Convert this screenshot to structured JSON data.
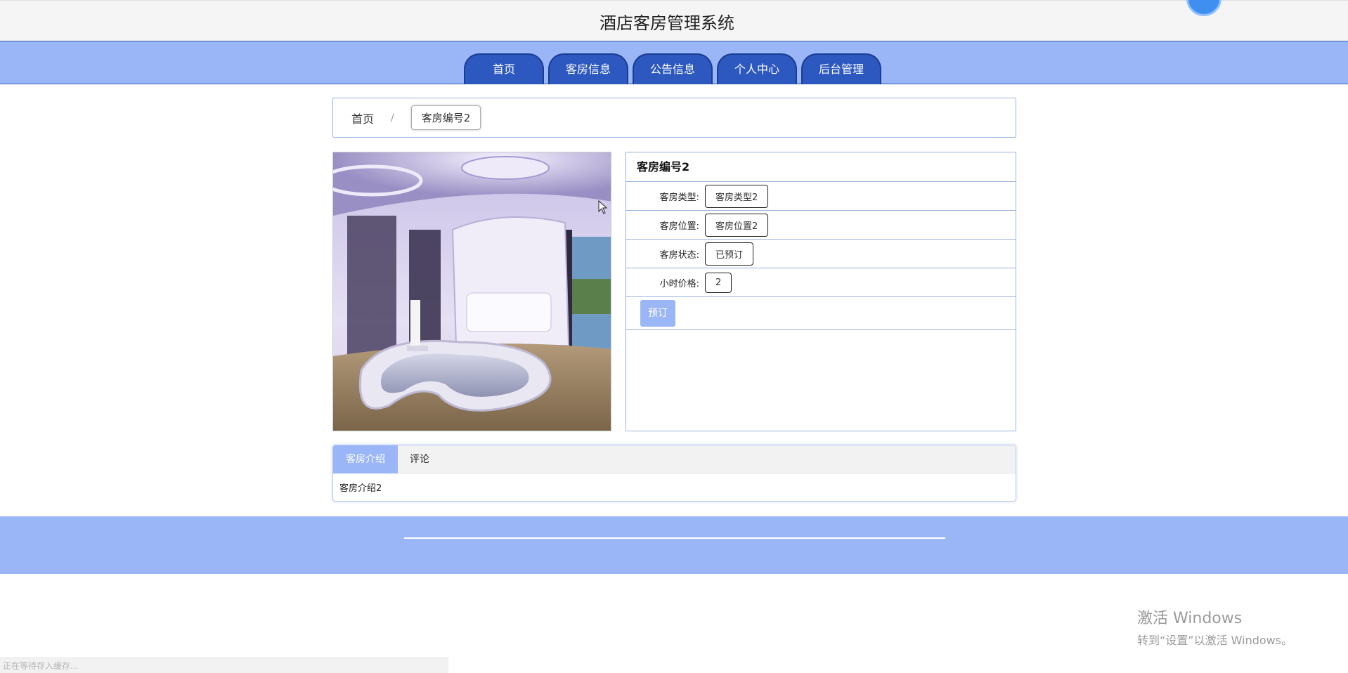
{
  "header": {
    "title": "酒店客房管理系统"
  },
  "nav": {
    "items": [
      "首页",
      "客房信息",
      "公告信息",
      "个人中心",
      "后台管理"
    ]
  },
  "breadcrumb": {
    "home": "首页",
    "separator": "/",
    "current": "客房编号2"
  },
  "room": {
    "image_icon": "room-photo",
    "title": "客房编号2",
    "fields": [
      {
        "label": "客房类型:",
        "value": "客房类型2"
      },
      {
        "label": "客房位置:",
        "value": "客房位置2"
      },
      {
        "label": "客房状态:",
        "value": "已预订"
      },
      {
        "label": "小时价格:",
        "value": "2"
      }
    ],
    "book_label": "预订"
  },
  "tabs": {
    "items": [
      "客房介绍",
      "评论"
    ],
    "active": "客房介绍",
    "content": "客房介绍2"
  },
  "watermark": {
    "title": "激活 Windows",
    "subtitle": "转到“设置”以激活 Windows。"
  },
  "status_bar": {
    "text": "正在等待存入缓存..."
  },
  "colors": {
    "nav_bg": "#9bb6f7",
    "nav_tab": "#2c58c0",
    "accent": "#9bb6f7"
  }
}
